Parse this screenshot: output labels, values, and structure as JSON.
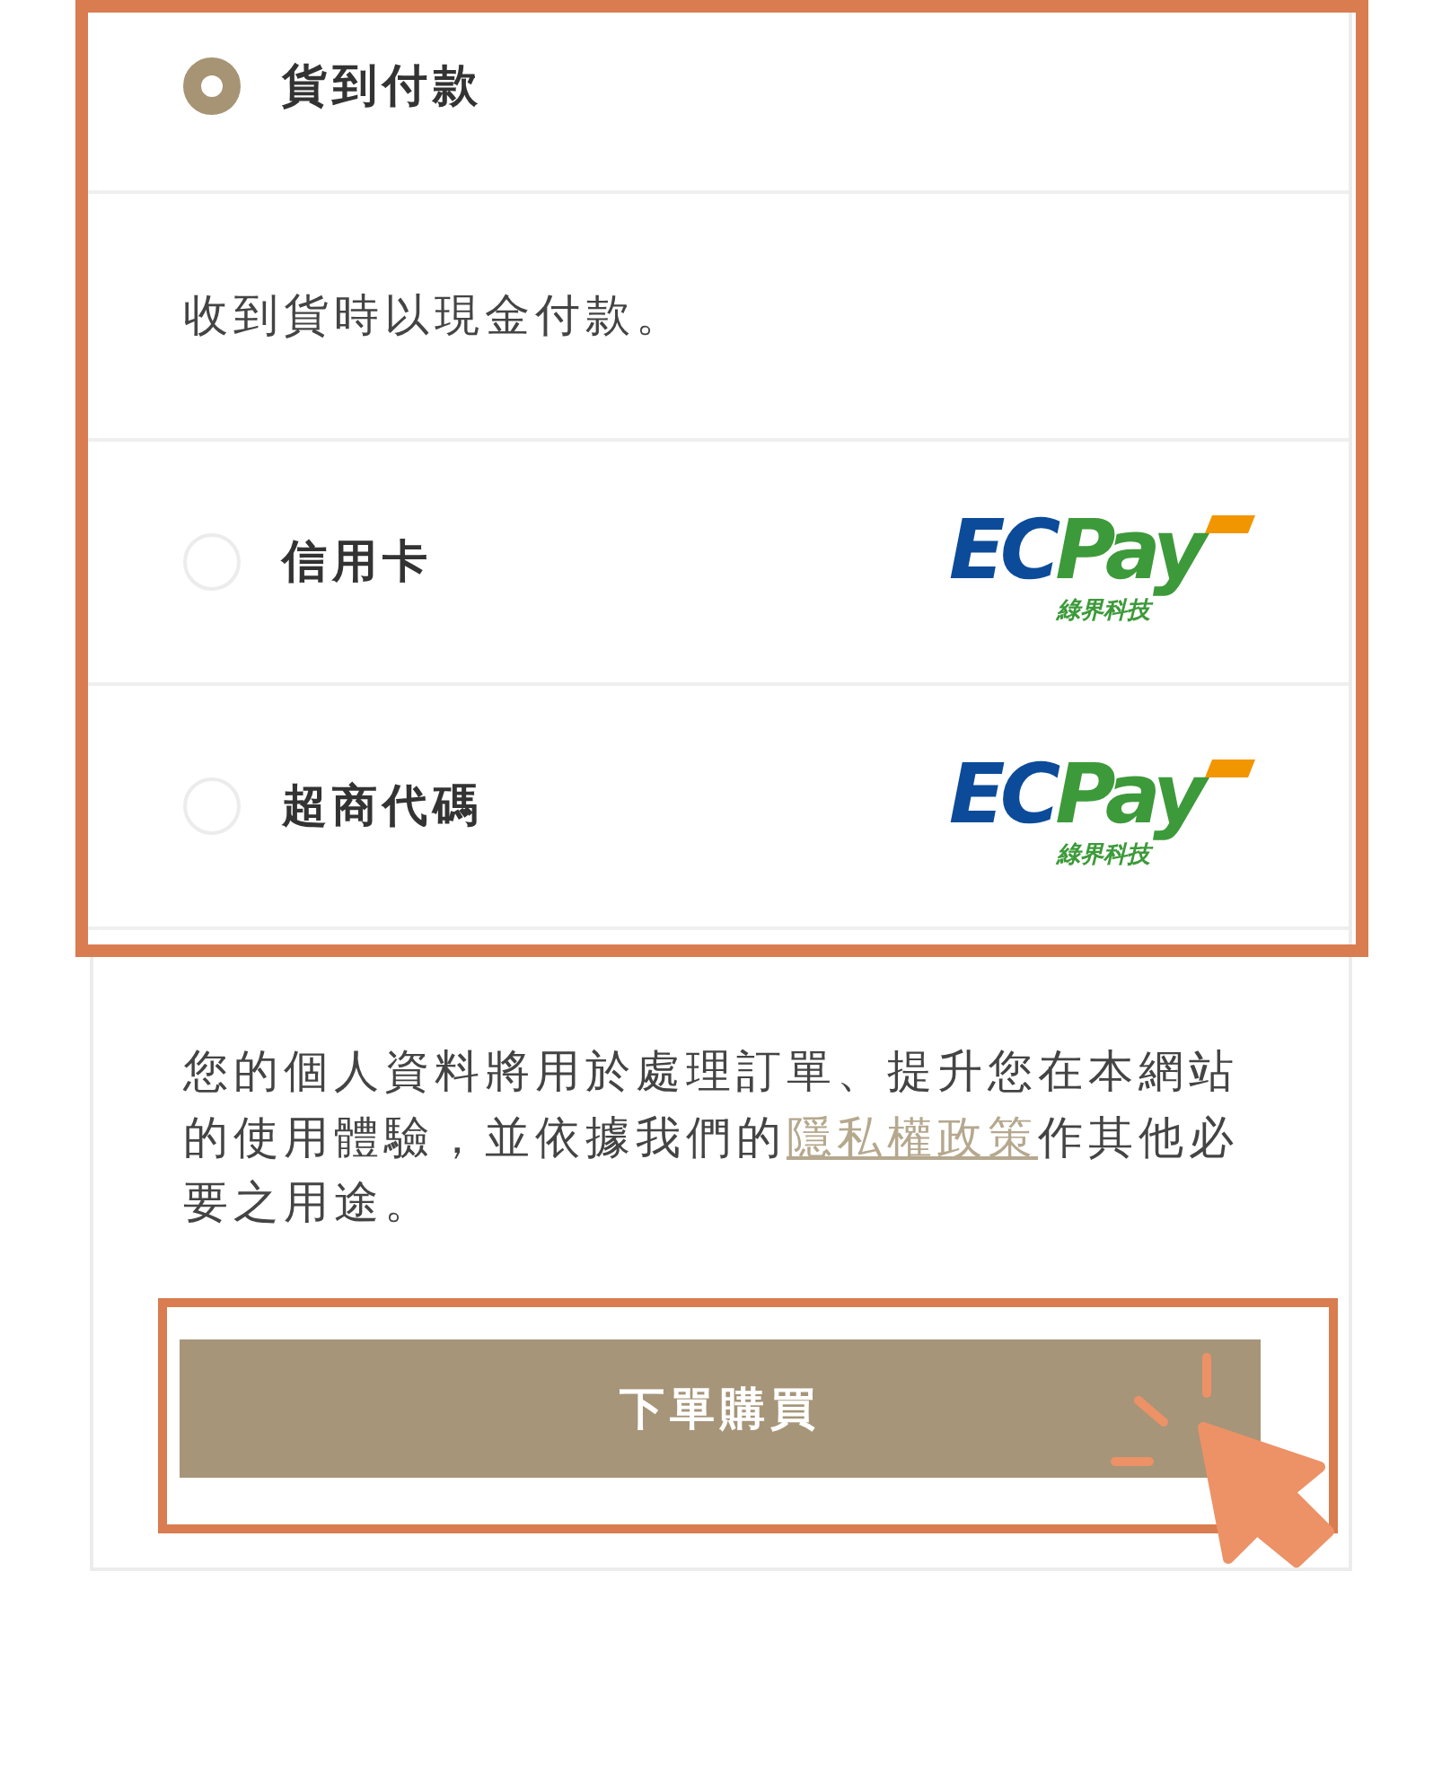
{
  "payment_methods": [
    {
      "label": "貨到付款",
      "selected": true,
      "description": "收到貨時以現金付款。"
    },
    {
      "label": "信用卡",
      "selected": false,
      "logo": {
        "wordmark": [
          "EC",
          "Pay"
        ],
        "tagline": "綠界科技"
      }
    },
    {
      "label": "超商代碼",
      "selected": false,
      "logo": {
        "wordmark": [
          "EC",
          "Pay"
        ],
        "tagline": "綠界科技"
      }
    }
  ],
  "privacy_notice": {
    "text_before": "您的個人資料將用於處理訂單、提升您在本網站的使用體驗，並依據我們的",
    "link": "隱私權政策",
    "text_after": "作其他必要之用途。"
  },
  "submit_button": {
    "label": "下單購買"
  }
}
